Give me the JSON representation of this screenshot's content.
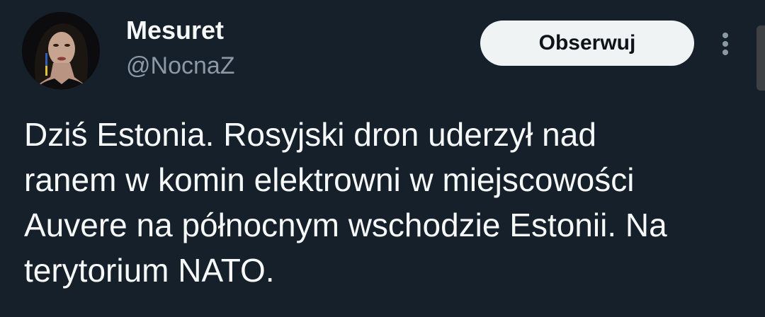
{
  "author": {
    "display_name": "Mesuret",
    "handle": "@NocnaZ"
  },
  "actions": {
    "follow_label": "Obserwuj",
    "more_icon": "more-vertical-icon"
  },
  "tweet": {
    "lines": [
      "Dziś Estonia. Rosyjski dron uderzył nad",
      "ranem w komin elektrowni w miejscowości",
      "Auvere na północnym wschodzie Estonii. Na",
      "terytorium NATO."
    ]
  },
  "colors": {
    "background": "#15202b",
    "text_primary": "#f7f9f9",
    "text_secondary": "#8b98a5",
    "button_bg": "#eff3f4",
    "button_text": "#0f1419"
  }
}
